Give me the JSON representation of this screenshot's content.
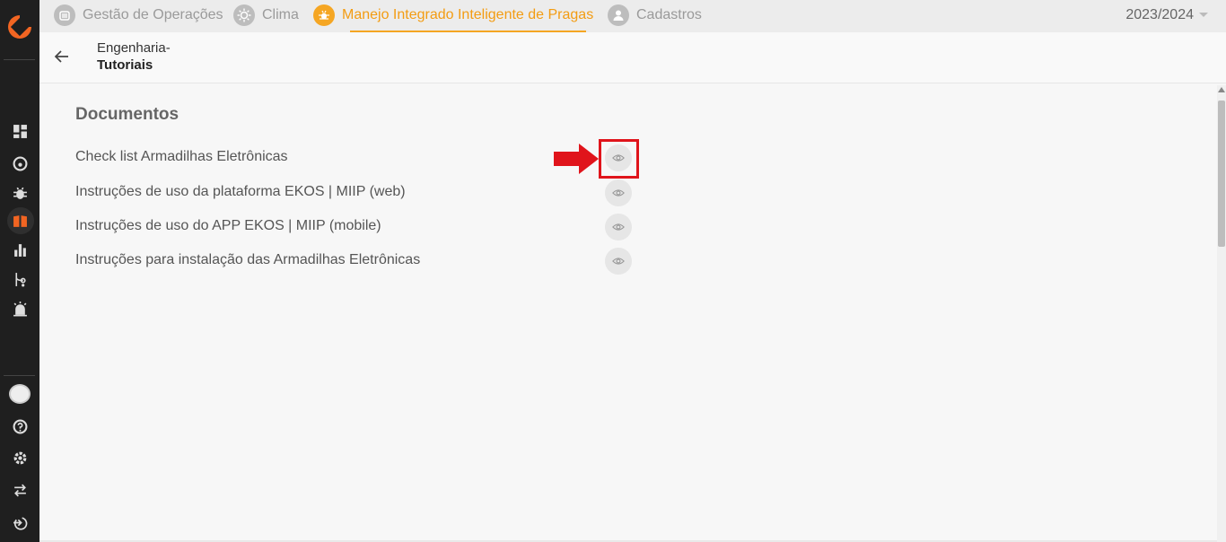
{
  "nav": {
    "tabs": [
      {
        "label": "Gestão de Operações",
        "icon": "operations-icon"
      },
      {
        "label": "Clima",
        "icon": "sun-icon"
      },
      {
        "label": "Manejo Integrado Inteligente de Pragas",
        "icon": "bug-sun-icon",
        "active": true
      },
      {
        "label": "Cadastros",
        "icon": "user-icon"
      }
    ],
    "season": "2023/2024"
  },
  "header": {
    "breadcrumb_parent": "Engenharia-",
    "breadcrumb_current": "Tutoriais"
  },
  "documents": {
    "title": "Documentos",
    "items": [
      {
        "label": "Check list Armadilhas Eletrônicas"
      },
      {
        "label": "Instruções de uso da plataforma EKOS | MIIP (web)"
      },
      {
        "label": "Instruções de uso do APP EKOS | MIIP (mobile)"
      },
      {
        "label": "Instruções para instalação das Armadilhas Eletrônicas"
      }
    ]
  },
  "colors": {
    "accent": "#f5a623",
    "sidebar": "#1f1f1f",
    "highlight": "#e0141b"
  }
}
